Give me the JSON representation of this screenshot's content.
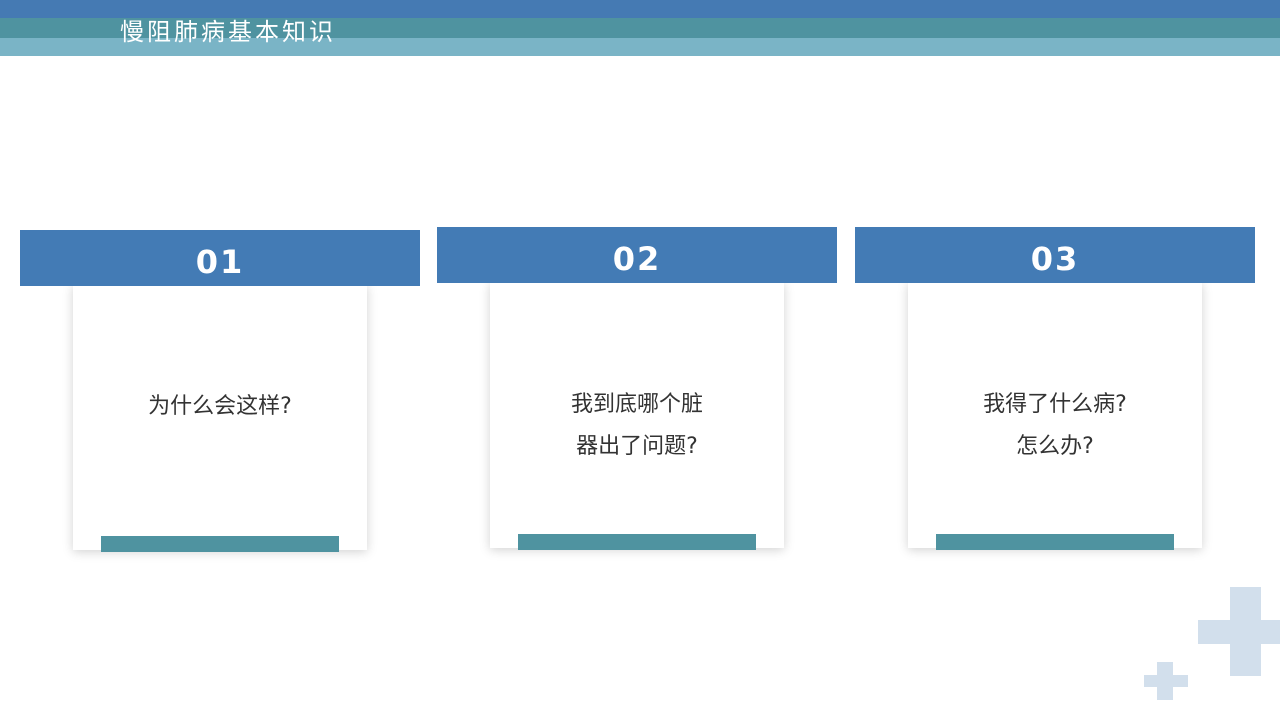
{
  "header": {
    "title": "慢阻肺病基本知识"
  },
  "cards": [
    {
      "number": "01",
      "lines": [
        "为什么会这样?"
      ]
    },
    {
      "number": "02",
      "lines": [
        "我到底哪个脏",
        "器出了问题?"
      ]
    },
    {
      "number": "03",
      "lines": [
        "我得了什么病?",
        "怎么办?"
      ]
    }
  ],
  "colors": {
    "header_stripe_top": "#457ab3",
    "header_stripe_mid": "#4f93a0",
    "header_stripe_bottom": "#7ab4c6",
    "card_header": "#437bb5",
    "card_bar": "#4f93a0",
    "decor_cross": "#d2dfec"
  },
  "icons": [
    "plus-cross-large-icon",
    "plus-cross-small-icon"
  ]
}
